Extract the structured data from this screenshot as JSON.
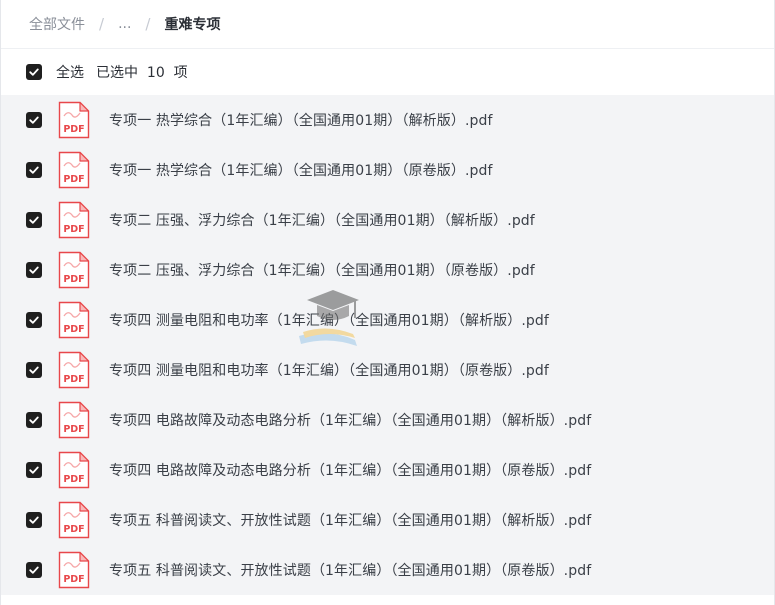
{
  "breadcrumb": {
    "root": "全部文件",
    "ellipsis": "...",
    "separator": "/",
    "current": "重难专项"
  },
  "selection": {
    "select_all": "全选",
    "selected_prefix": "已选中",
    "count": "10",
    "unit": "项"
  },
  "files": [
    {
      "name": "专项一 热学综合（1年汇编）（全国通用01期）（解析版）.pdf",
      "icon": "pdf-icon",
      "checked": true
    },
    {
      "name": "专项一 热学综合（1年汇编）（全国通用01期）（原卷版）.pdf",
      "icon": "pdf-icon",
      "checked": true
    },
    {
      "name": "专项二 压强、浮力综合（1年汇编）（全国通用01期）（解析版）.pdf",
      "icon": "pdf-icon",
      "checked": true
    },
    {
      "name": "专项二 压强、浮力综合（1年汇编）（全国通用01期）（原卷版）.pdf",
      "icon": "pdf-icon",
      "checked": true
    },
    {
      "name": "专项四 测量电阻和电功率（1年汇编）（全国通用01期）（解析版）.pdf",
      "icon": "pdf-icon",
      "checked": true
    },
    {
      "name": "专项四 测量电阻和电功率（1年汇编）（全国通用01期）（原卷版）.pdf",
      "icon": "pdf-icon",
      "checked": true
    },
    {
      "name": "专项四 电路故障及动态电路分析（1年汇编）（全国通用01期）（解析版）.pdf",
      "icon": "pdf-icon",
      "checked": true
    },
    {
      "name": "专项四 电路故障及动态电路分析（1年汇编）（全国通用01期）（原卷版）.pdf",
      "icon": "pdf-icon",
      "checked": true
    },
    {
      "name": "专项五 科普阅读文、开放性试题（1年汇编）（全国通用01期）（解析版）.pdf",
      "icon": "pdf-icon",
      "checked": true
    },
    {
      "name": "专项五 科普阅读文、开放性试题（1年汇编）（全国通用01期）（原卷版）.pdf",
      "icon": "pdf-icon",
      "checked": true
    }
  ],
  "pdf_icon_label": "PDF",
  "colors": {
    "checkbox": "#1f1f1f",
    "list_background": "#f3f4f6",
    "pdf_red": "#e8474a",
    "pdf_fold": "#f8b9ba"
  }
}
